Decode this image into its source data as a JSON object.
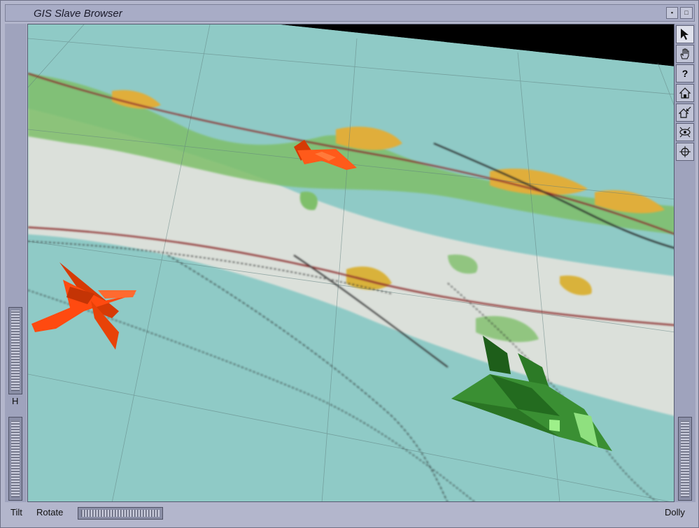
{
  "window": {
    "title": "GIS Slave Browser"
  },
  "toolbar": {
    "tools": [
      {
        "name": "pick-icon",
        "label": "Pick"
      },
      {
        "name": "hand-icon",
        "label": "View"
      },
      {
        "name": "help-icon",
        "label": "?"
      },
      {
        "name": "home-icon",
        "label": "Home"
      },
      {
        "name": "set-home-icon",
        "label": "Set Home"
      },
      {
        "name": "view-all-icon",
        "label": "View All"
      },
      {
        "name": "seek-icon",
        "label": "Seek"
      }
    ]
  },
  "wheels": {
    "left_top_label": "H",
    "tilt_label": "Tilt",
    "rotate_label": "Rotate",
    "dolly_label": "Dolly"
  },
  "scene": {
    "map_water_color": "#8fcac6",
    "aircraft": [
      {
        "name": "red-fighter-jet-large",
        "color": "#ff4a10"
      },
      {
        "name": "red-fighter-jet-small",
        "color": "#ff5a1a"
      },
      {
        "name": "green-stealth-aircraft",
        "color": "#2f8f2a"
      }
    ]
  }
}
